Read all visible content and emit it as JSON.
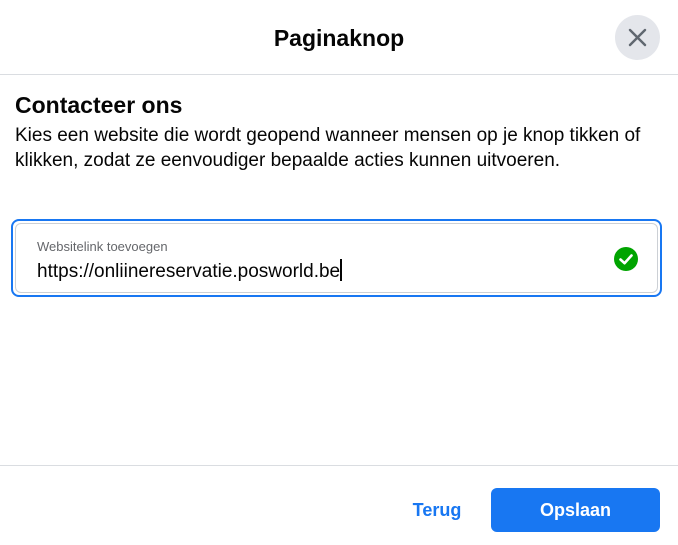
{
  "dialog": {
    "title": "Paginaknop",
    "close_icon": "close-icon"
  },
  "section": {
    "title": "Contacteer ons",
    "description": "Kies een website die wordt geopend wanneer mensen op je knop tikken of klikken, zodat ze eenvoudiger bepaalde acties kunnen uitvoeren."
  },
  "website_input": {
    "label": "Websitelink toevoegen",
    "value": "https://onliinereservatie.posworld.be",
    "status_icon": "check-circle-icon",
    "status_color": "#00a400"
  },
  "footer": {
    "back_label": "Terug",
    "save_label": "Opslaan"
  },
  "colors": {
    "accent": "#1877f2",
    "close_bg": "#e4e6eb",
    "divider": "#dadde1"
  }
}
